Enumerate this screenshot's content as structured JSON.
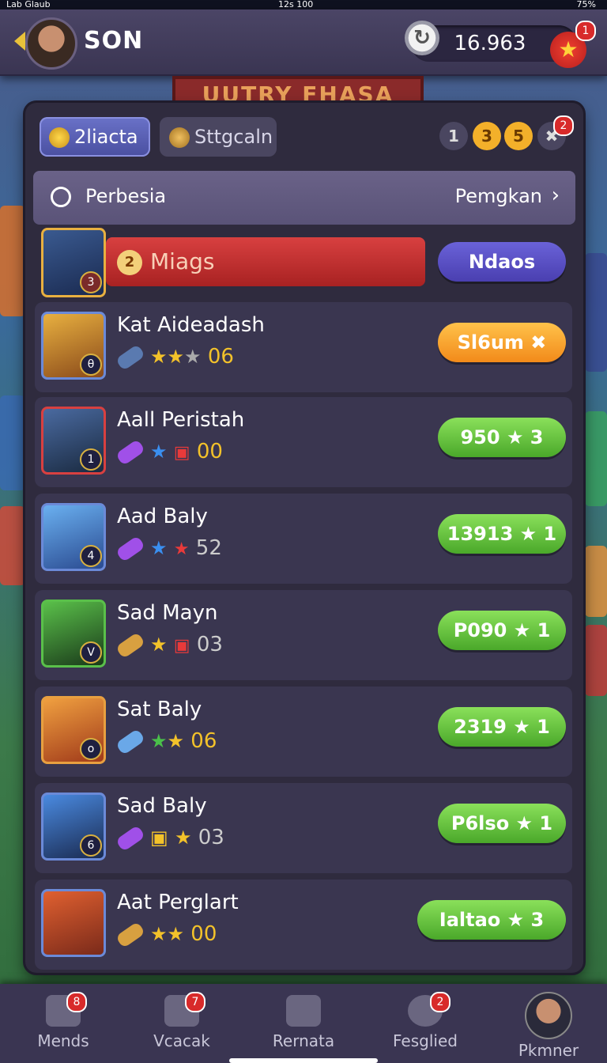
{
  "status": {
    "left": "Lab  Glaub",
    "center": "12s 100",
    "right": "75%"
  },
  "header": {
    "player_name": "SON",
    "coins": "16.963",
    "star_badge": "1",
    "refresh_icon": "↻",
    "star_icon": "★"
  },
  "banner": {
    "text": "UUTRY FHASA"
  },
  "tabs": [
    {
      "label": "2liacta"
    },
    {
      "label": "Sttgcaln"
    }
  ],
  "pills": [
    "1",
    "3",
    "5"
  ],
  "settings_badge": "2",
  "section": {
    "title": "Perbesia",
    "link": "Pemgkan",
    "chevron": "›"
  },
  "featured": {
    "rank": "2",
    "name": "Miags",
    "button": "Ndaos",
    "level": "3"
  },
  "heroes": [
    {
      "name": "Kat Aideadash",
      "stat": "06",
      "button": "Sl6um ✖",
      "level": "θ"
    },
    {
      "name": "Aall Peristah",
      "stat": "00",
      "button": "950 ★ 3",
      "level": "1"
    },
    {
      "name": "Aad Baly",
      "stat": "52",
      "button": "13913 ★ 1",
      "level": "4"
    },
    {
      "name": "Sad Mayn",
      "stat": "03",
      "button": "P090 ★ 1",
      "level": "V"
    },
    {
      "name": "Sat Baly",
      "stat": "06",
      "button": "2319 ★ 1",
      "level": "o"
    },
    {
      "name": "Sad Baly",
      "stat": "03",
      "button": "P6lso ★ 1",
      "level": "6"
    },
    {
      "name": "Aat Perglart",
      "stat": "00",
      "button": "Ialtao ★ 3",
      "level": ""
    }
  ],
  "nav": [
    {
      "label": "Mends",
      "badge": "8"
    },
    {
      "label": "Vcacak",
      "badge": "7"
    },
    {
      "label": "Rernata",
      "badge": ""
    },
    {
      "label": "Fesglied",
      "badge": "2"
    },
    {
      "label": "Pkmner",
      "badge": ""
    }
  ],
  "colors": {
    "accent_green": "#5cbf33",
    "accent_orange": "#f5a020",
    "accent_purple": "#5a4fc8",
    "featured_red": "#c9302c"
  }
}
